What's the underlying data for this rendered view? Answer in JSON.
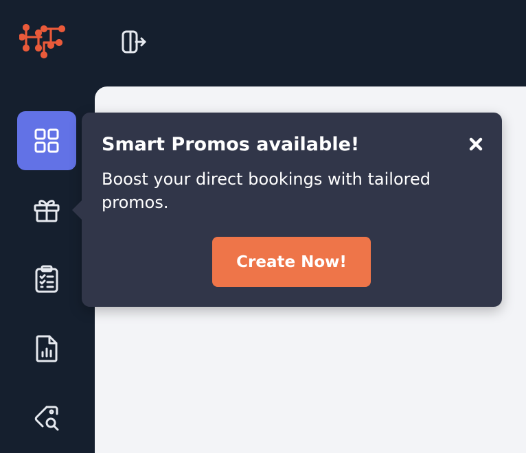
{
  "header": {
    "logo_icon": "hotel-network-logo",
    "logout_icon": "logout-icon"
  },
  "sidebar": {
    "items": [
      {
        "icon": "dashboard-grid-icon",
        "active": true
      },
      {
        "icon": "gift-icon",
        "active": false
      },
      {
        "icon": "clipboard-checklist-icon",
        "active": false
      },
      {
        "icon": "report-chart-icon",
        "active": false
      },
      {
        "icon": "tag-search-icon",
        "active": false
      }
    ]
  },
  "tooltip": {
    "title": "Smart Promos available!",
    "body": "Boost your direct bookings with tailored promos.",
    "cta_label": "Create Now!",
    "close_icon": "close-icon"
  },
  "colors": {
    "sidebar_bg": "#151f2e",
    "active_nav_bg": "#6272e6",
    "tooltip_bg": "#313649",
    "cta_bg": "#ee7549",
    "logo": "#ea5a3a",
    "main_bg": "#f3f4f7"
  }
}
